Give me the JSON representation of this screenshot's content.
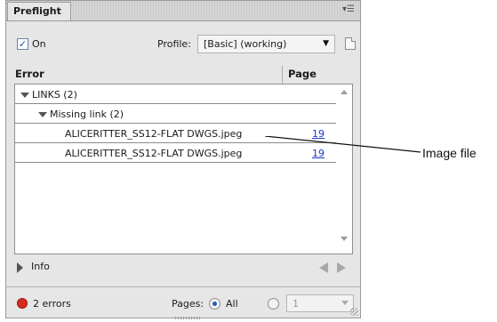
{
  "panel": {
    "tab_label": "Preflight",
    "on_label": "On",
    "on_checked": true,
    "profile_label": "Profile:",
    "profile_value": "[Basic] (working)"
  },
  "columns": {
    "error": "Error",
    "page": "Page"
  },
  "rows": [
    {
      "label": "LINKS (2)",
      "page": ""
    },
    {
      "label": "Missing link (2)",
      "page": ""
    },
    {
      "label": "ALICERITTER_SS12-FLAT DWGS.jpeg",
      "page": "19"
    },
    {
      "label": "ALICERITTER_SS12-FLAT DWGS.jpeg",
      "page": "19"
    }
  ],
  "info_label": "Info",
  "footer": {
    "errors_label": "2 errors",
    "pages_label": "Pages:",
    "all_label": "All",
    "range_value": "1"
  },
  "annotation": {
    "label": "Image file"
  },
  "colors": {
    "error_dot": "#d82a1e",
    "page_link": "#1b35c9"
  }
}
